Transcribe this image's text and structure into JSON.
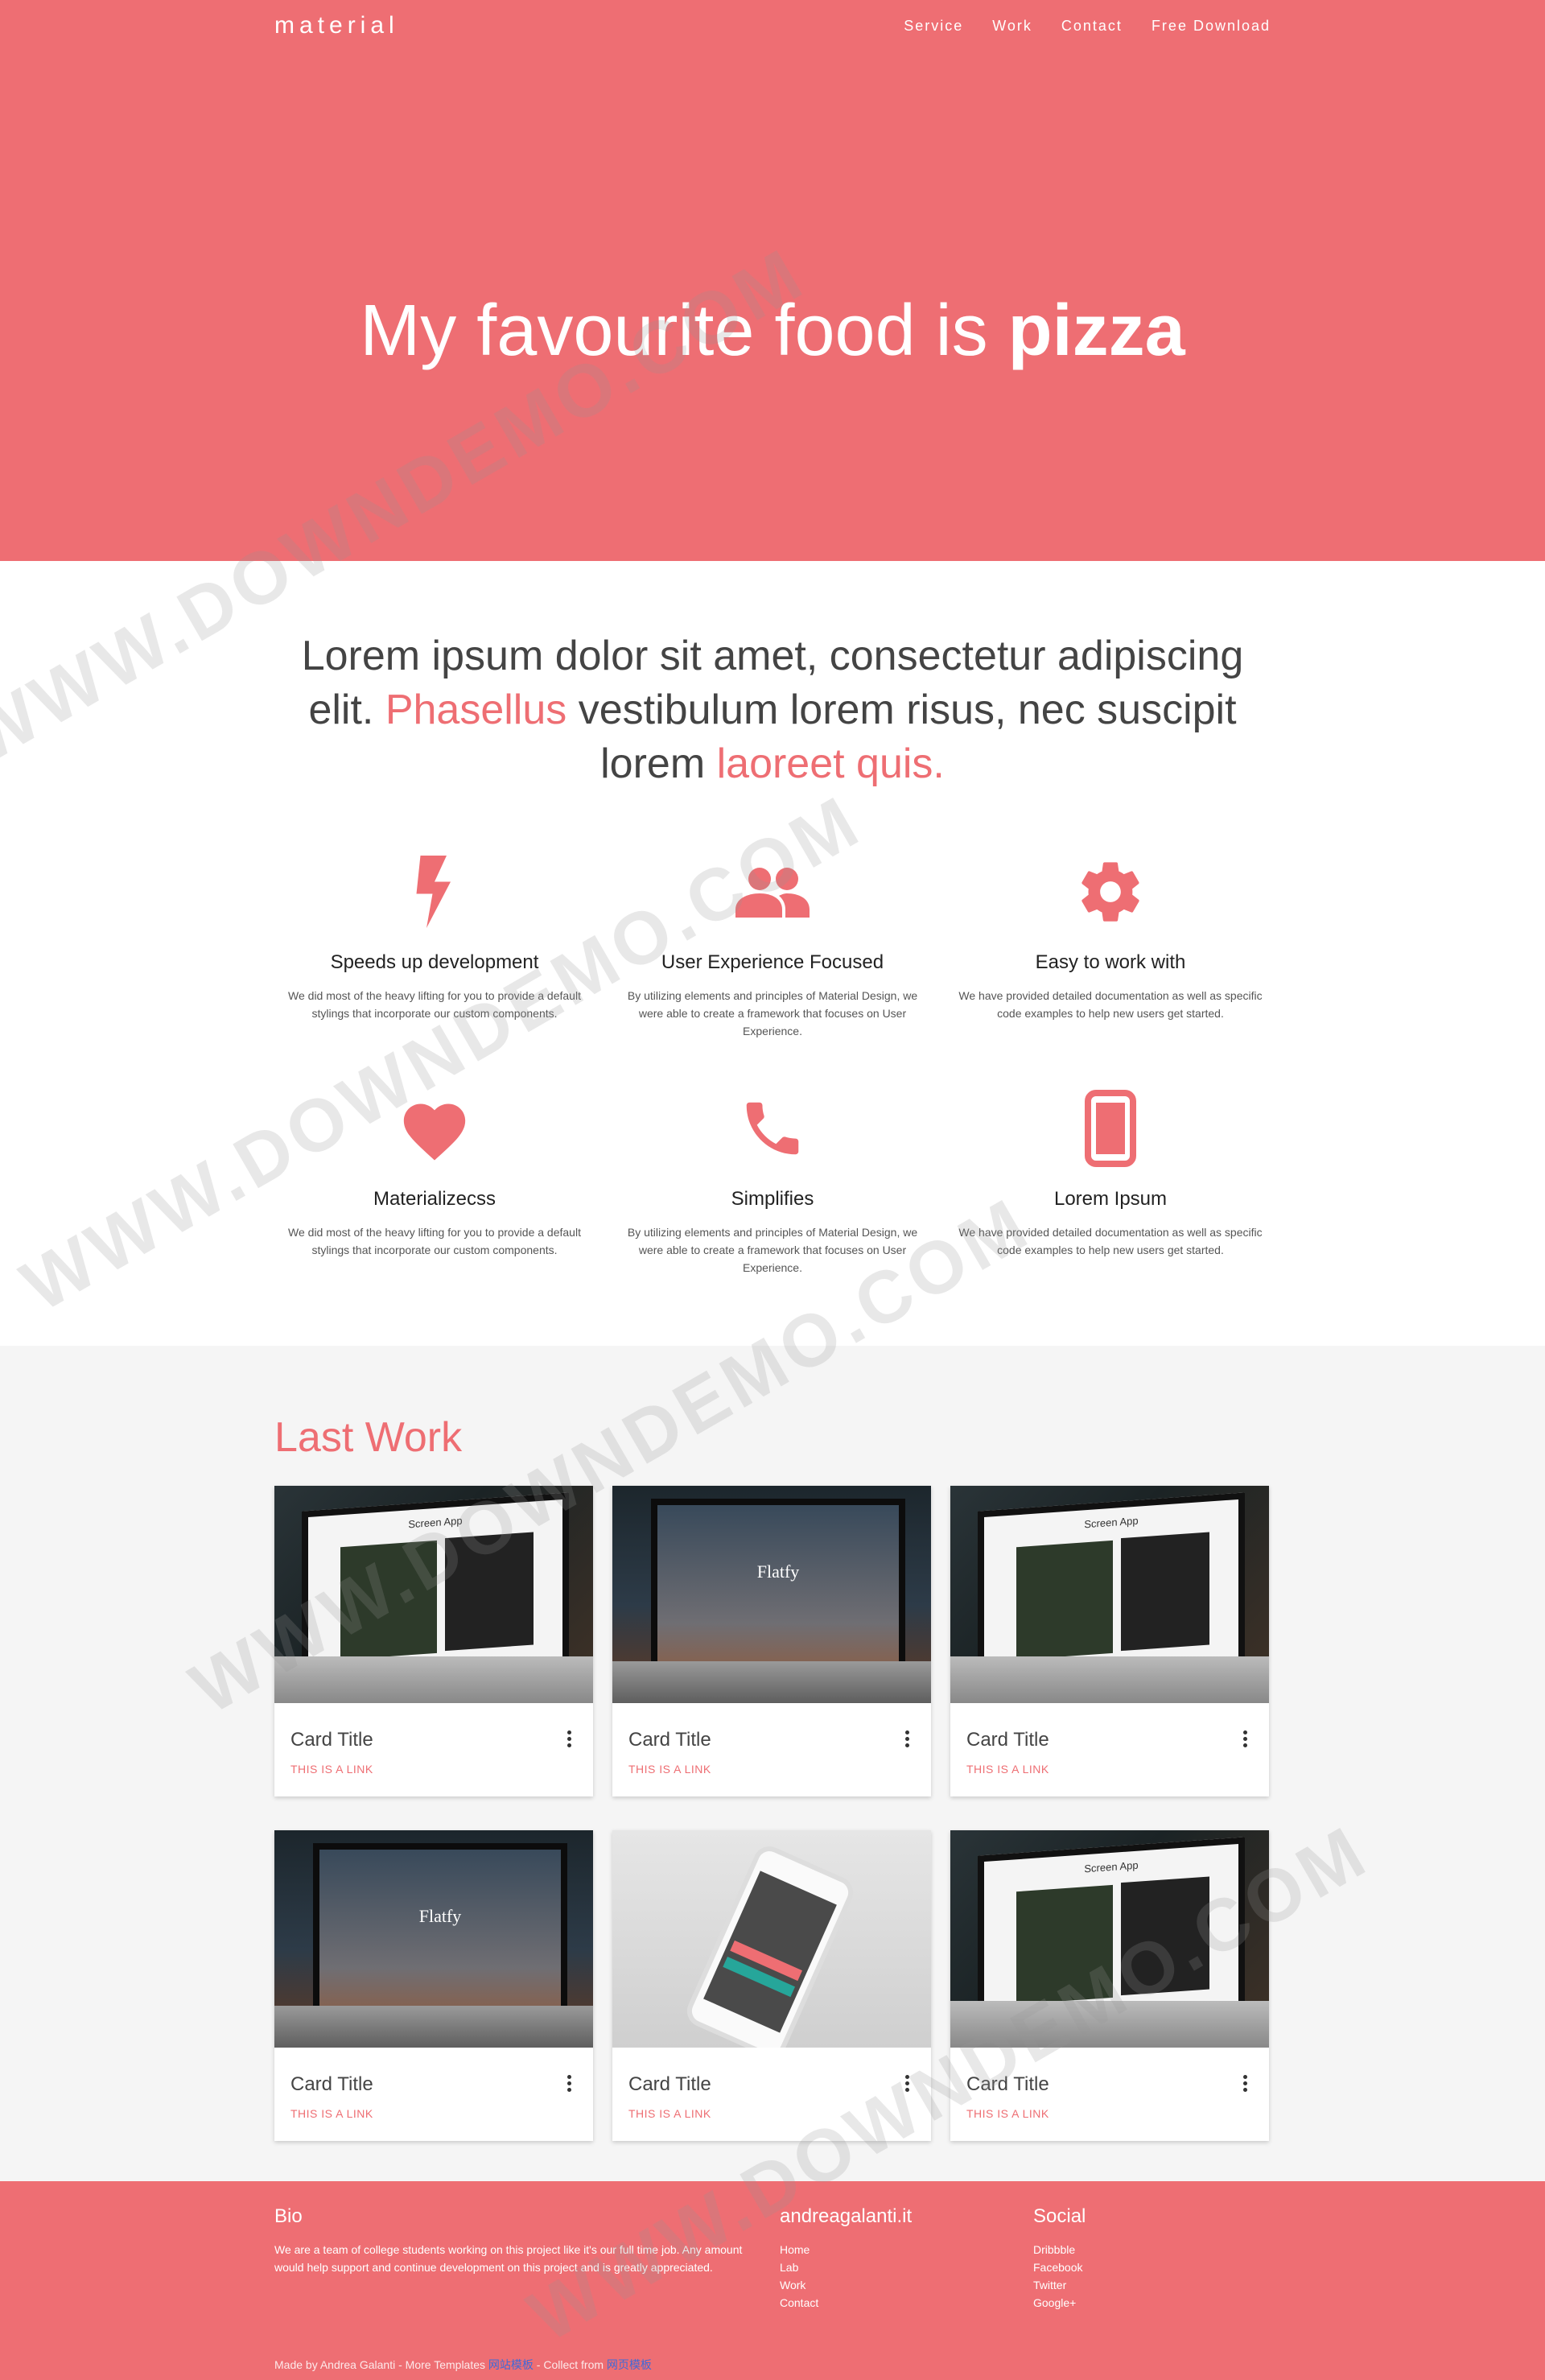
{
  "nav": {
    "brand": "material",
    "items": [
      "Service",
      "Work",
      "Contact",
      "Free Download"
    ]
  },
  "hero": {
    "title_pre": "My favourite food is ",
    "title_bold": "pizza"
  },
  "intro": {
    "part1": "Lorem ipsum dolor sit amet, consectetur adipiscing elit. ",
    "hl1": "Phasellus",
    "part2": " vestibulum lorem risus, nec suscipit lorem ",
    "hl2": "laoreet quis."
  },
  "features": [
    {
      "icon": "bolt-icon",
      "title": "Speeds up development",
      "desc": "We did most of the heavy lifting for you to provide a default stylings that incorporate our custom components."
    },
    {
      "icon": "group-icon",
      "title": "User Experience Focused",
      "desc": "By utilizing elements and principles of Material Design, we were able to create a framework that focuses on User Experience."
    },
    {
      "icon": "gear-icon",
      "title": "Easy to work with",
      "desc": "We have provided detailed documentation as well as specific code examples to help new users get started."
    },
    {
      "icon": "heart-icon",
      "title": "Materializecss",
      "desc": "We did most of the heavy lifting for you to provide a default stylings that incorporate our custom components."
    },
    {
      "icon": "phone-icon",
      "title": "Simplifies",
      "desc": "By utilizing elements and principles of Material Design, we were able to create a framework that focuses on User Experience."
    },
    {
      "icon": "smartphone-icon",
      "title": "Lorem Ipsum",
      "desc": "We have provided detailed documentation as well as specific code examples to help new users get started."
    }
  ],
  "work": {
    "title": "Last Work",
    "cards": [
      {
        "image": "laptop-screen-app",
        "image_text": "Screen App",
        "title": "Card Title",
        "link": "This is a link"
      },
      {
        "image": "laptop-flatfy",
        "image_text": "Flatfy",
        "title": "Card Title",
        "link": "This is a link"
      },
      {
        "image": "laptop-screen-app",
        "image_text": "Screen App",
        "title": "Card Title",
        "link": "This is a link"
      },
      {
        "image": "laptop-flatfy",
        "image_text": "Flatfy",
        "title": "Card Title",
        "link": "This is a link"
      },
      {
        "image": "phone-in-hand",
        "image_text": "",
        "title": "Card Title",
        "link": "This is a link"
      },
      {
        "image": "laptop-screen-app",
        "image_text": "Screen App",
        "title": "Card Title",
        "link": "This is a link"
      }
    ]
  },
  "footer": {
    "bio_title": "Bio",
    "bio_text": "We are a team of college students working on this project like it's our full time job. Any amount would help support and continue development on this project and is greatly appreciated.",
    "site_title": "andreagalanti.it",
    "site_links": [
      "Home",
      "Lab",
      "Work",
      "Contact"
    ],
    "social_title": "Social",
    "social_links": [
      "Dribbble",
      "Facebook",
      "Twitter",
      "Google+"
    ],
    "credits_pre": "Made by ",
    "credits_author": "Andrea Galanti",
    "credits_mid": " - More Templates ",
    "credits_link1": "网站模板",
    "credits_mid2": " - Collect from ",
    "credits_link2": "网页模板"
  },
  "watermark": "WWW.DOWNDEMO.COM",
  "colors": {
    "accent": "#ee6e73",
    "work_bg": "#f5f5f5"
  }
}
